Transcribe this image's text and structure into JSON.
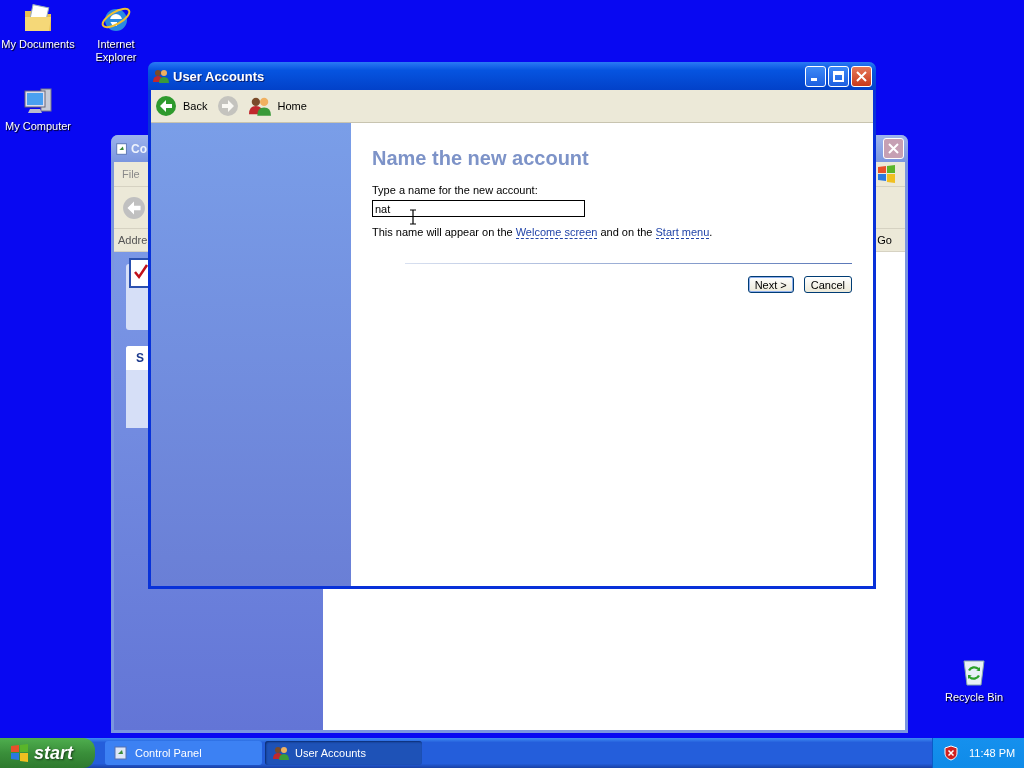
{
  "desktop_icons": [
    {
      "label": "My Documents",
      "kind": "documents"
    },
    {
      "label": "Internet Explorer",
      "kind": "browser"
    },
    {
      "label": "My Computer",
      "kind": "computer"
    }
  ],
  "recycle_bin": {
    "label": "Recycle Bin"
  },
  "back_window": {
    "title": "Co",
    "menu": [
      "File"
    ],
    "address_label": "Addre",
    "go": "Go",
    "card_title": "S"
  },
  "window": {
    "title": "User Accounts",
    "toolbar": [
      {
        "kind": "back",
        "label": "Back",
        "disabled": false
      },
      {
        "kind": "forward",
        "disabled": true
      },
      {
        "kind": "home",
        "label": "Home",
        "disabled": false
      }
    ],
    "heading": "Name the new account",
    "field_label": "Type a name for the new account:",
    "field_value": "nat",
    "hint": [
      {
        "kind": "text",
        "text": "This name will appear on the "
      },
      {
        "kind": "link",
        "text": "Welcome screen"
      },
      {
        "kind": "text",
        "text": " and on the "
      },
      {
        "kind": "link",
        "text": "Start menu"
      },
      {
        "kind": "text",
        "text": "."
      }
    ],
    "buttons": [
      {
        "label": "Next >",
        "default": true
      },
      {
        "label": "Cancel",
        "default": false
      }
    ]
  },
  "taskbar": {
    "start": "start",
    "tasks": [
      {
        "label": "Control Panel",
        "kind": "control-panel",
        "selected": false
      },
      {
        "label": "User Accounts",
        "kind": "users",
        "selected": true
      }
    ],
    "clock": "11:48 PM"
  }
}
